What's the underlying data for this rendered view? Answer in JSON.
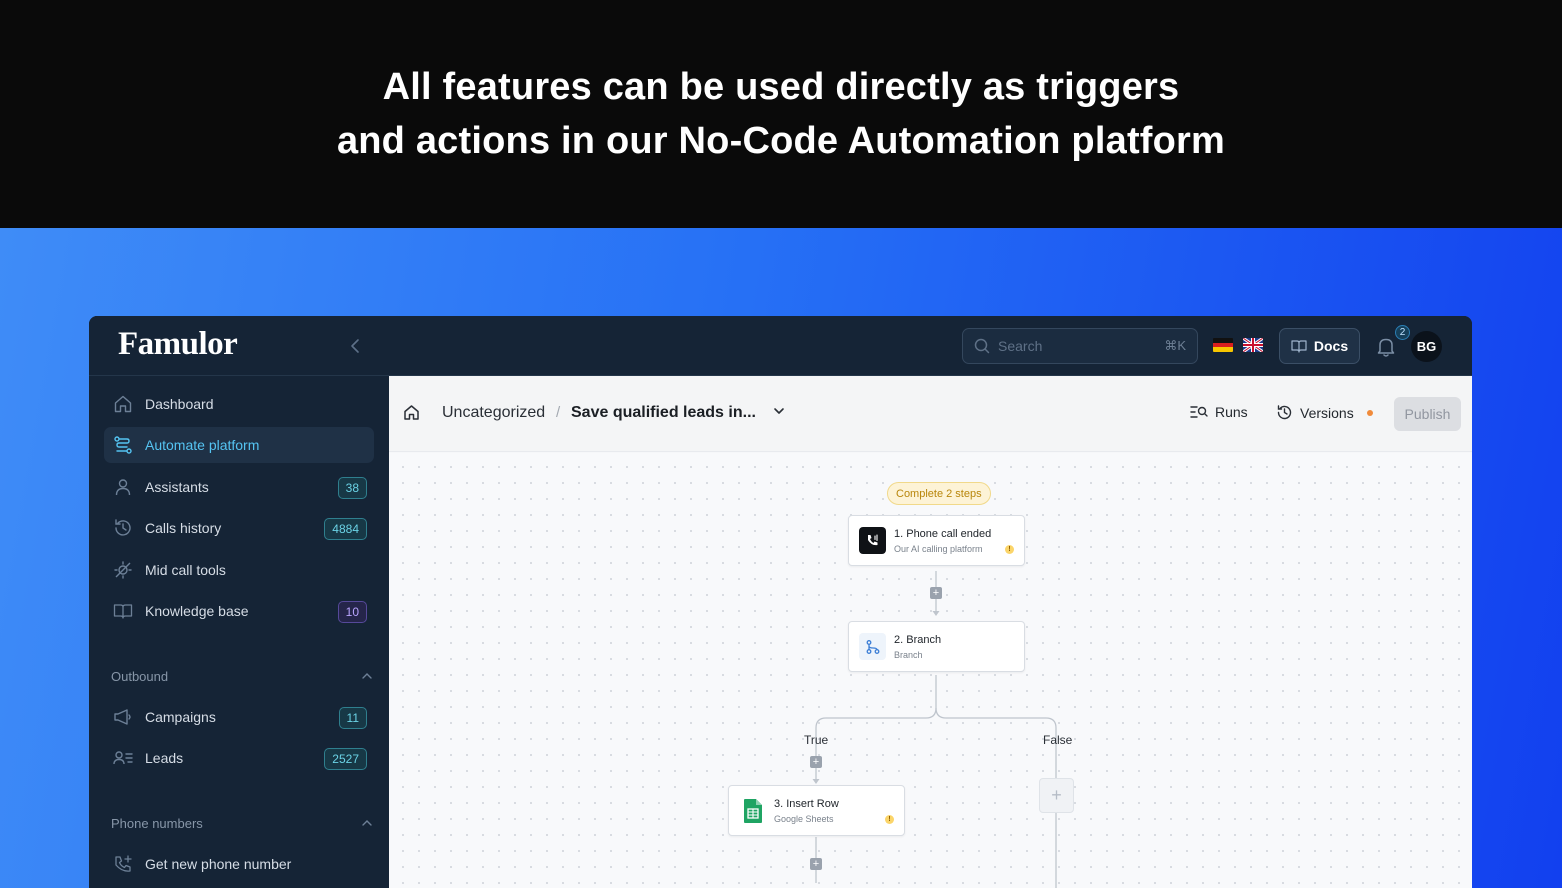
{
  "banner": {
    "line1": "All features can be used directly as triggers",
    "line2": "and actions in our No-Code Automation platform"
  },
  "app": {
    "logo": "Famulor",
    "search": {
      "placeholder": "Search",
      "shortcut": "⌘K"
    },
    "languages": [
      "de-flag-icon",
      "uk-flag-icon"
    ],
    "docs_label": "Docs",
    "notifications_count": "2",
    "avatar_initials": "BG"
  },
  "sidebar": {
    "items": [
      {
        "label": "Dashboard",
        "icon": "home-icon",
        "badge": ""
      },
      {
        "label": "Automate platform",
        "icon": "workflow-icon",
        "badge": "",
        "active": true
      },
      {
        "label": "Assistants",
        "icon": "user-icon",
        "badge": "38"
      },
      {
        "label": "Calls history",
        "icon": "history-icon",
        "badge": "4884"
      },
      {
        "label": "Mid call tools",
        "icon": "tools-icon",
        "badge": ""
      },
      {
        "label": "Knowledge base",
        "icon": "book-icon",
        "badge": "10"
      }
    ],
    "outbound": {
      "title": "Outbound",
      "items": [
        {
          "label": "Campaigns",
          "icon": "megaphone-icon",
          "badge": "11"
        },
        {
          "label": "Leads",
          "icon": "leads-icon",
          "badge": "2527"
        }
      ]
    },
    "phone_numbers": {
      "title": "Phone numbers",
      "items": [
        {
          "label": "Get new phone number",
          "icon": "phone-plus-icon"
        }
      ]
    }
  },
  "workflow_bar": {
    "breadcrumb_folder": "Uncategorized",
    "breadcrumb_separator": "/",
    "workflow_name": "Save qualified leads in...",
    "runs_label": "Runs",
    "versions_label": "Versions",
    "publish_label": "Publish"
  },
  "canvas": {
    "status_pill": "Complete 2 steps",
    "nodes": [
      {
        "title": "1. Phone call ended",
        "subtitle": "Our AI calling platform",
        "icon": "phone-call-icon",
        "warning": true
      },
      {
        "title": "2. Branch",
        "subtitle": "Branch",
        "icon": "branch-icon",
        "warning": false
      },
      {
        "title": "3. Insert Row",
        "subtitle": "Google Sheets",
        "icon": "google-sheets-icon",
        "warning": true
      }
    ],
    "branch_labels": {
      "true": "True",
      "false": "False"
    },
    "warning_glyph": "!",
    "plus_glyph": "+"
  },
  "colors": {
    "accent": "#55c4f2",
    "sidebar_bg": "#152436",
    "stage_gradient_start": "#3f8cf7",
    "stage_gradient_end": "#1240ef"
  }
}
